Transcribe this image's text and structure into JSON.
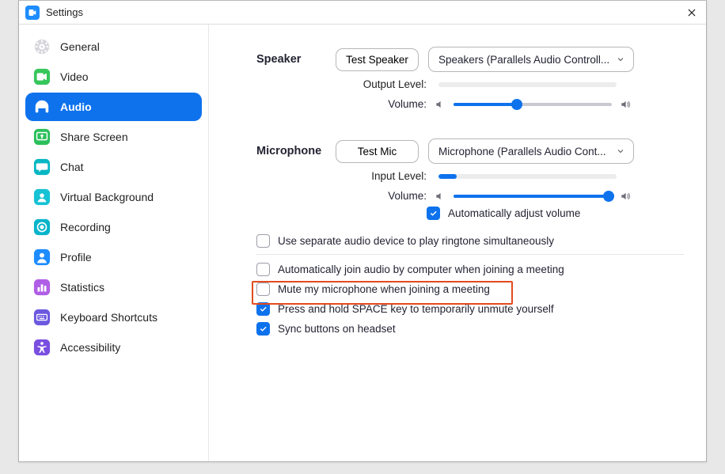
{
  "window": {
    "title": "Settings"
  },
  "sidebar": {
    "items": [
      {
        "label": "General"
      },
      {
        "label": "Video"
      },
      {
        "label": "Audio"
      },
      {
        "label": "Share Screen"
      },
      {
        "label": "Chat"
      },
      {
        "label": "Virtual Background"
      },
      {
        "label": "Recording"
      },
      {
        "label": "Profile"
      },
      {
        "label": "Statistics"
      },
      {
        "label": "Keyboard Shortcuts"
      },
      {
        "label": "Accessibility"
      }
    ],
    "active_index": 2
  },
  "speaker": {
    "section_label": "Speaker",
    "test_label": "Test Speaker",
    "device": "Speakers (Parallels Audio Controll...",
    "output_level_label": "Output Level:",
    "volume_label": "Volume:",
    "output_level_pct": 0,
    "volume_pct": 40
  },
  "microphone": {
    "section_label": "Microphone",
    "test_label": "Test Mic",
    "device": "Microphone (Parallels Audio Cont...",
    "input_level_label": "Input Level:",
    "volume_label": "Volume:",
    "input_level_pct": 10,
    "volume_pct": 98,
    "auto_adjust_label": "Automatically adjust volume",
    "auto_adjust_checked": true
  },
  "options": {
    "separate_ringtone": {
      "label": "Use separate audio device to play ringtone simultaneously",
      "checked": false
    },
    "auto_join_audio": {
      "label": "Automatically join audio by computer when joining a meeting",
      "checked": false
    },
    "mute_on_join": {
      "label": "Mute my microphone when joining a meeting",
      "checked": false
    },
    "space_unmute": {
      "label": "Press and hold SPACE key to temporarily unmute yourself",
      "checked": true
    },
    "sync_headset": {
      "label": "Sync buttons on headset",
      "checked": true
    }
  }
}
